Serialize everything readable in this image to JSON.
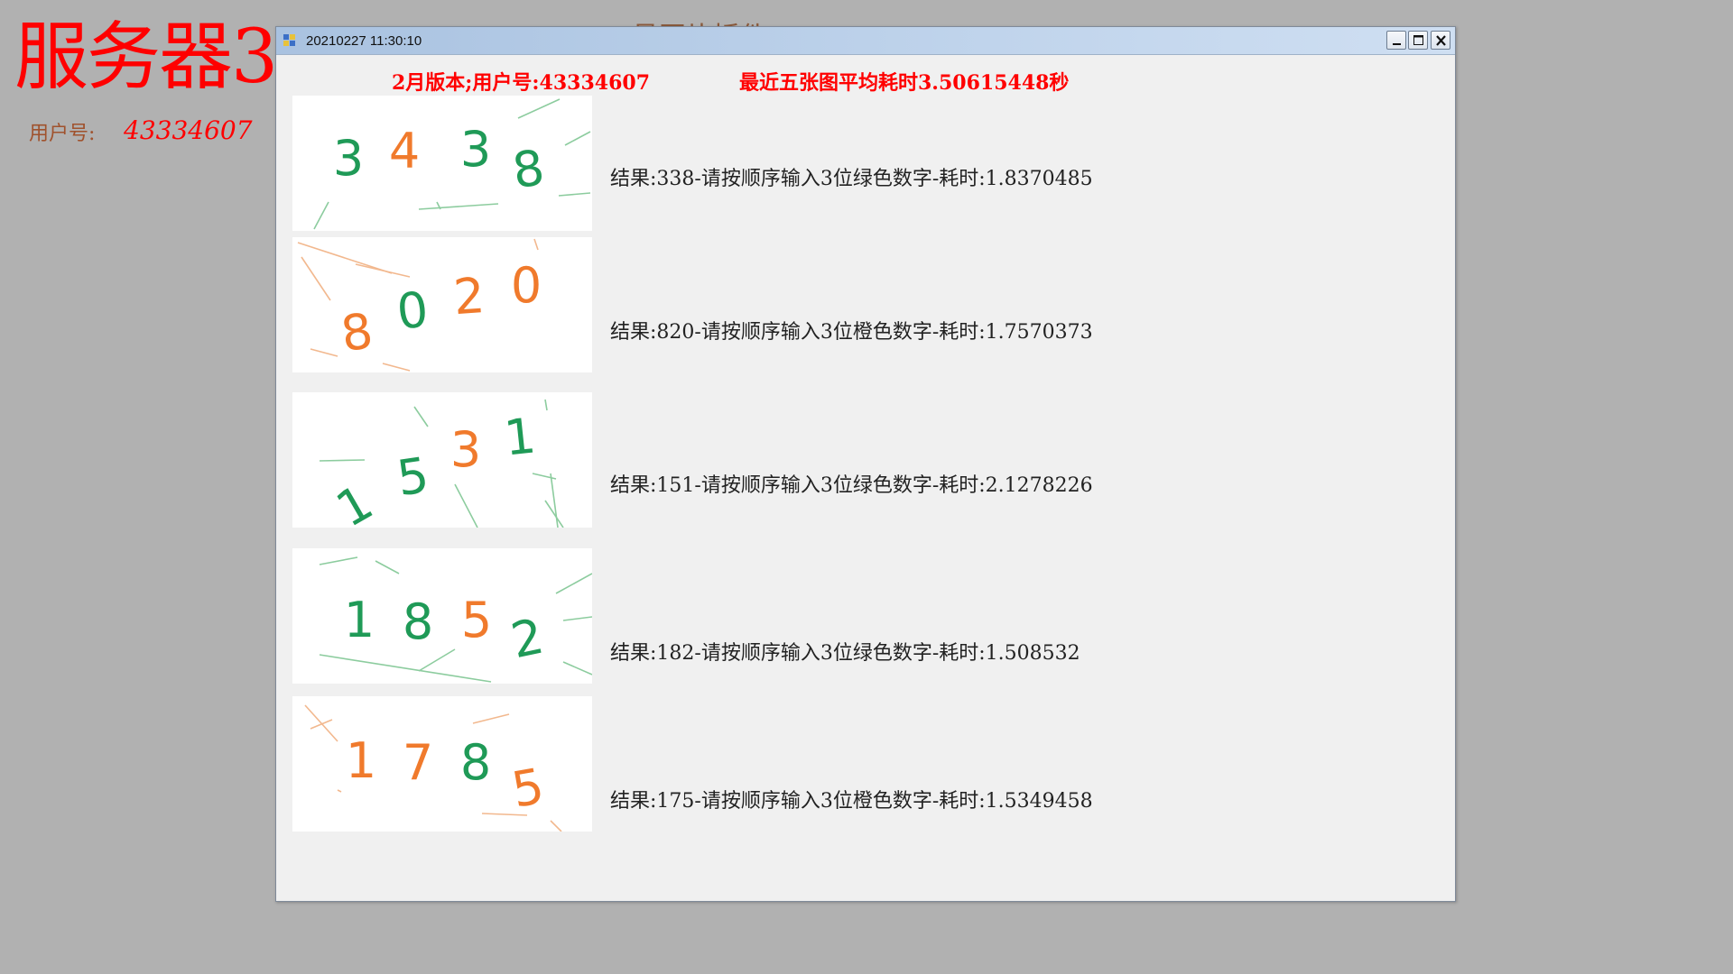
{
  "background": {
    "title": "服务器3",
    "subtitle": "号图片插件",
    "user_label": "用户号:",
    "user_value": "43334607"
  },
  "window": {
    "title": "20210227 11:30:10",
    "heading_left": "2月版本;用户号:43334607",
    "heading_right": "最近五张图平均耗时3.50615448秒"
  },
  "colors": {
    "heading_red": "#ff0000",
    "digit_green": "#1f9a57",
    "digit_orange": "#f07a2c",
    "noise_green": "#8ccc9e",
    "noise_orange": "#f2b88e"
  },
  "results": [
    {
      "captcha_digits": [
        {
          "char": "3",
          "color": "green"
        },
        {
          "char": "4",
          "color": "orange"
        },
        {
          "char": "3",
          "color": "green"
        },
        {
          "char": "8",
          "color": "green"
        }
      ],
      "text": "结果:338-请按顺序输入3位绿色数字-耗时:1.8370485"
    },
    {
      "captcha_digits": [
        {
          "char": "8",
          "color": "orange"
        },
        {
          "char": "0",
          "color": "green"
        },
        {
          "char": "2",
          "color": "orange"
        },
        {
          "char": "0",
          "color": "orange"
        }
      ],
      "text": "结果:820-请按顺序输入3位橙色数字-耗时:1.7570373"
    },
    {
      "captcha_digits": [
        {
          "char": "1",
          "color": "green"
        },
        {
          "char": "5",
          "color": "green"
        },
        {
          "char": "3",
          "color": "orange"
        },
        {
          "char": "1",
          "color": "green"
        }
      ],
      "text": "结果:151-请按顺序输入3位绿色数字-耗时:2.1278226"
    },
    {
      "captcha_digits": [
        {
          "char": "1",
          "color": "green"
        },
        {
          "char": "8",
          "color": "green"
        },
        {
          "char": "5",
          "color": "orange"
        },
        {
          "char": "2",
          "color": "green"
        }
      ],
      "text": "结果:182-请按顺序输入3位绿色数字-耗时:1.508532"
    },
    {
      "captcha_digits": [
        {
          "char": "1",
          "color": "orange"
        },
        {
          "char": "7",
          "color": "orange"
        },
        {
          "char": "8",
          "color": "green"
        },
        {
          "char": "5",
          "color": "orange"
        }
      ],
      "text": "结果:175-请按顺序输入3位橙色数字-耗时:1.5349458"
    }
  ]
}
